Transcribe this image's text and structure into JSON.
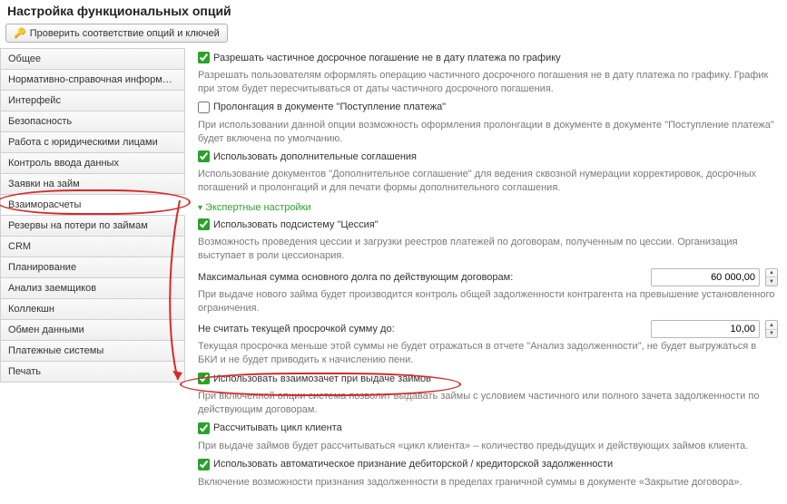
{
  "title": "Настройка функциональных опций",
  "toolbar": {
    "check_button": "Проверить соответствие опций и ключей"
  },
  "sidebar": {
    "items": [
      {
        "label": "Общее"
      },
      {
        "label": "Нормативно-справочная информация"
      },
      {
        "label": "Интерфейс"
      },
      {
        "label": "Безопасность"
      },
      {
        "label": "Работа с юридическими лицами"
      },
      {
        "label": "Контроль ввода данных"
      },
      {
        "label": "Заявки на займ"
      },
      {
        "label": "Взаиморасчеты"
      },
      {
        "label": "Резервы на потери по займам"
      },
      {
        "label": "CRM"
      },
      {
        "label": "Планирование"
      },
      {
        "label": "Анализ заемщиков"
      },
      {
        "label": "Коллекшн"
      },
      {
        "label": "Обмен данными"
      },
      {
        "label": "Платежные системы"
      },
      {
        "label": "Печать"
      }
    ],
    "active_index": 7
  },
  "content": {
    "opt_partial_early": {
      "label": "Разрешать частичное досрочное погашение не в дату платежа по графику",
      "checked": true,
      "desc": "Разрешать пользователям оформлять операцию частичного досрочного погашения не в дату платежа по графику. График при этом будет пересчитываться от даты частичного досрочного погашения."
    },
    "opt_prolong": {
      "label": "Пролонгация в документе \"Поступление платежа\"",
      "checked": false,
      "desc": "При использовании данной опции возможность оформления пролонгации в документе в документе \"Поступление платежа\" будет включена по умолчанию."
    },
    "opt_addagr": {
      "label": "Использовать дополнительные соглашения",
      "checked": true,
      "desc": "Использование документов \"Дополнительное соглашение\" для ведения сквозной нумерации корректировок, досрочных погашений и пролонгаций и для печати формы дополнительного соглашения."
    },
    "expert_link": "Экспертные настройки",
    "opt_cession": {
      "label": "Использовать подсистему \"Цессия\"",
      "checked": true,
      "desc": "Возможность проведения цессии и загрузки реестров платежей по договорам, полученным по цессии. Организация выступает в роли цессионария."
    },
    "field_max_debt": {
      "label": "Максимальная сумма основного долга по действующим договорам:",
      "value": "60 000,00",
      "desc": "При выдаче нового займа будет производится контроль общей задолженности контрагента на превышение установленного ограничения."
    },
    "field_overdue": {
      "label": "Не считать текущей просрочкой сумму до:",
      "value": "10,00",
      "desc": "Текущая просрочка меньше этой суммы не будет отражаться в отчете \"Анализ задолженности\", не будет выгружаться в БКИ и не будет приводить к начислению пени."
    },
    "opt_offset": {
      "label": "Использовать взаимозачет при выдаче займов",
      "checked": true,
      "desc": "При включенной опции система позволит выдавать займы с условием частичного или полного зачета задолженности по действующим договорам."
    },
    "opt_cycle": {
      "label": "Рассчитывать цикл клиента",
      "checked": true,
      "desc": "При выдаче займов будет рассчитываться «цикл клиента» – количество предыдущих и действующих займов клиента."
    },
    "opt_auto_ack": {
      "label": "Использовать автоматическое признание дебиторской / кредиторской задолженности",
      "checked": true,
      "desc": "Включение возможности признания задолженности в пределах граничной суммы в документе «Закрытие договора»."
    }
  }
}
